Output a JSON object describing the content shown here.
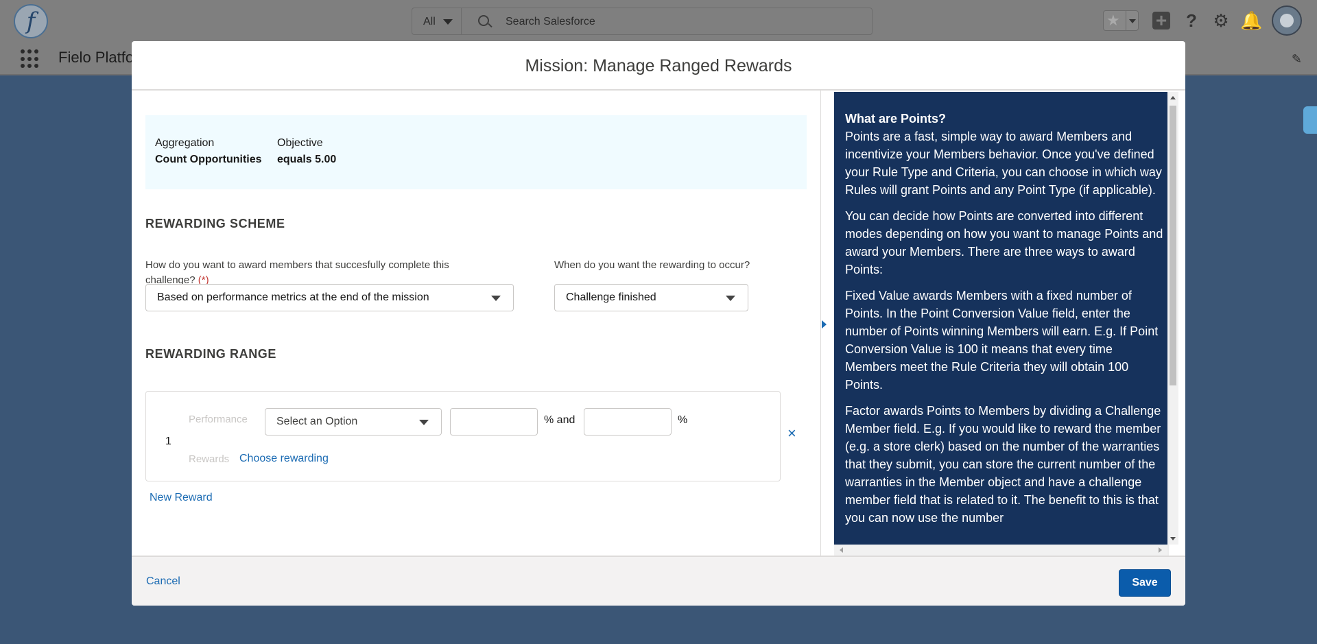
{
  "header": {
    "logo_glyph": "f",
    "search_scope": "All",
    "search_placeholder": "Search Salesforce",
    "help_glyph": "?",
    "gear_glyph": "⚙",
    "bell_glyph": "🔔",
    "plus_glyph": "+",
    "star_glyph": "★"
  },
  "nav": {
    "app_name": "Fielo Platfo",
    "pencil_glyph": "✎"
  },
  "modal": {
    "title": "Mission: Manage Ranged Rewards",
    "summary": {
      "aggregation_label": "Aggregation",
      "aggregation_value": "Count Opportunities",
      "objective_label": "Objective",
      "objective_value": "equals 5.00"
    },
    "rewarding_scheme": {
      "title": "REWARDING SCHEME",
      "award_question": "How do you want to award members that succesfully complete this challenge?",
      "required_mark": "(*)",
      "award_selected": "Based on performance metrics at the end of the mission",
      "timing_question": "When do you want the rewarding to occur?",
      "timing_selected": "Challenge finished"
    },
    "rewarding_range": {
      "title": "REWARDING RANGE",
      "rows": [
        {
          "index": "1",
          "performance_label": "Performance",
          "option_placeholder": "Select an Option",
          "and_unit": "% and",
          "end_unit": "%",
          "rewards_label": "Rewards",
          "choose_link": "Choose rewarding",
          "remove_glyph": "×"
        }
      ],
      "new_reward_link": "New Reward"
    },
    "help": {
      "heading": "What are Points?",
      "paragraphs": [
        "Points are a fast, simple way to award Members and incentivize your Members behavior. Once you've defined your Rule Type and Criteria, you can choose in which way Rules will grant Points and any Point Type (if applicable).",
        "You can decide how Points are converted into different modes depending on how you want to manage Points and award your Members. There are three ways to award Points:",
        "Fixed Value awards Members with a fixed number of Points. In the Point Conversion Value field, enter the number of Points winning Members will earn. E.g. If Point Conversion Value is 100 it means that every time Members meet the Rule Criteria they will obtain 100 Points.",
        "Factor awards Points to Members by dividing a Challenge Member field. E.g. If you would like to reward the member (e.g. a store clerk) based on the number of the warranties that they submit, you can store the current number of the warranties in the Member object and have a challenge member field that is related to it. The benefit to this is that you can now use the number"
      ]
    },
    "footer": {
      "cancel_label": "Cancel",
      "save_label": "Save"
    }
  }
}
